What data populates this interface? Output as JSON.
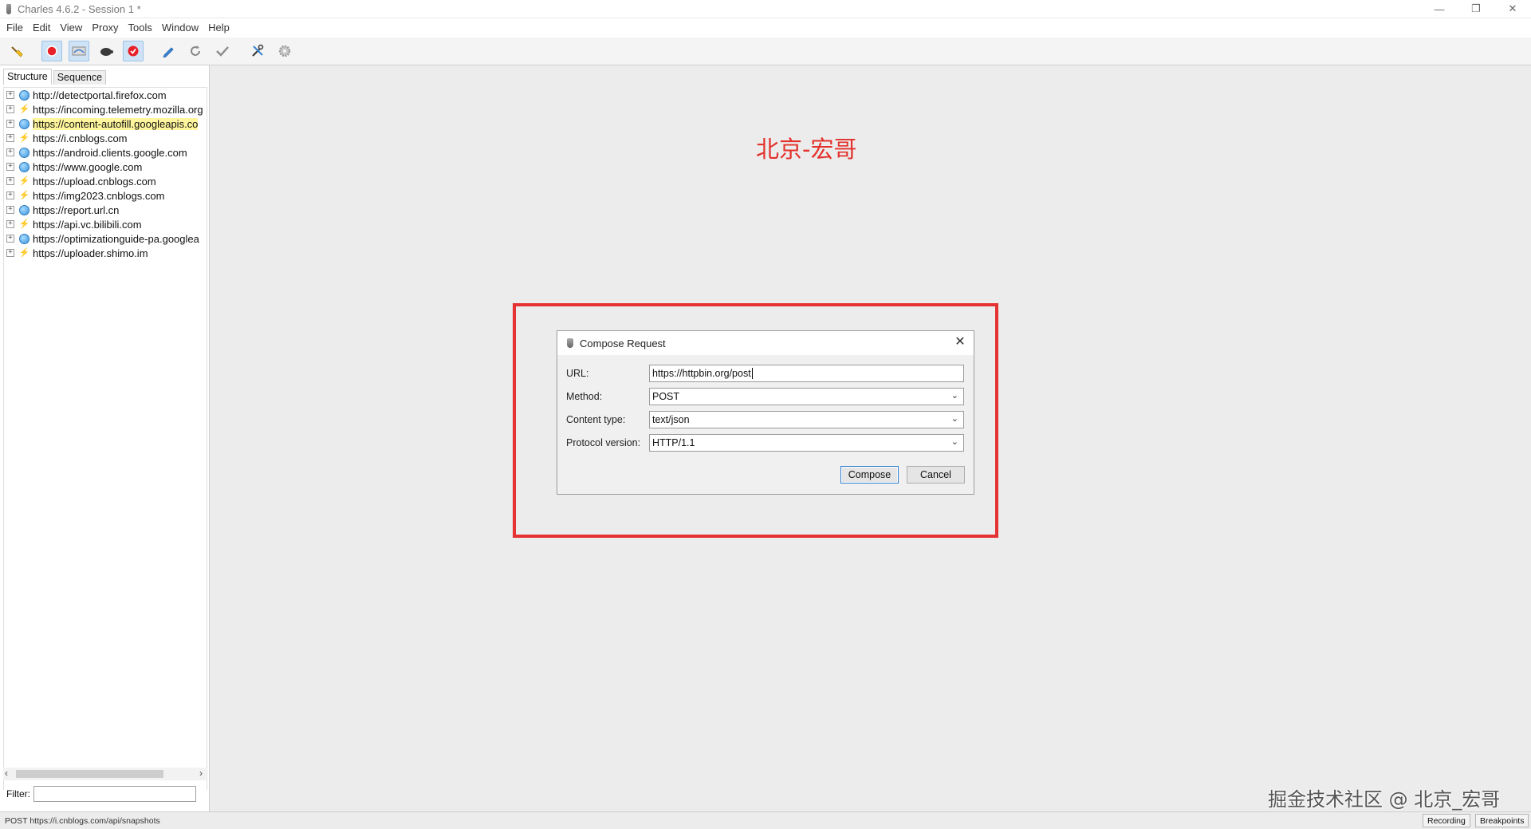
{
  "window": {
    "title": "Charles 4.6.2 - Session 1 *",
    "controls": [
      "—",
      "❐",
      "✕"
    ]
  },
  "menu": [
    "File",
    "Edit",
    "View",
    "Proxy",
    "Tools",
    "Window",
    "Help"
  ],
  "toolbar": {
    "buttons": [
      "broom-icon",
      "record-icon",
      "throttle-icon",
      "turtle-icon",
      "breakpoint-icon",
      "compose-pen-icon",
      "repeat-icon",
      "validate-check-icon",
      "tools-icon",
      "settings-gear-icon"
    ]
  },
  "left_panel": {
    "tabs": {
      "structure": "Structure",
      "sequence": "Sequence"
    },
    "hosts": [
      {
        "label": "http://detectportal.firefox.com",
        "icon": "globe",
        "highlighted": false
      },
      {
        "label": "https://incoming.telemetry.mozilla.org",
        "icon": "bolt",
        "highlighted": false
      },
      {
        "label": "https://content-autofill.googleapis.co",
        "icon": "globe",
        "highlighted": true
      },
      {
        "label": "https://i.cnblogs.com",
        "icon": "bolt",
        "highlighted": false
      },
      {
        "label": "https://android.clients.google.com",
        "icon": "globe",
        "highlighted": false
      },
      {
        "label": "https://www.google.com",
        "icon": "globe",
        "highlighted": false
      },
      {
        "label": "https://upload.cnblogs.com",
        "icon": "bolt",
        "highlighted": false
      },
      {
        "label": "https://img2023.cnblogs.com",
        "icon": "bolt",
        "highlighted": false
      },
      {
        "label": "https://report.url.cn",
        "icon": "globe",
        "highlighted": false
      },
      {
        "label": "https://api.vc.bilibili.com",
        "icon": "bolt",
        "highlighted": false
      },
      {
        "label": "https://optimizationguide-pa.googlea",
        "icon": "globe",
        "highlighted": false
      },
      {
        "label": "https://uploader.shimo.im",
        "icon": "bolt",
        "highlighted": false
      }
    ],
    "filter_label": "Filter:",
    "filter_value": ""
  },
  "main": {
    "watermark_top": "北京-宏哥",
    "watermark_bottom": "掘金技术社区 @ 北京_宏哥",
    "frame_color": "#e53233"
  },
  "dialog": {
    "title": "Compose Request",
    "fields": {
      "url_label": "URL:",
      "url_value": "https://httpbin.org/post",
      "method_label": "Method:",
      "method_value": "POST",
      "content_type_label": "Content type:",
      "content_type_value": "text/json",
      "protocol_label": "Protocol version:",
      "protocol_value": "HTTP/1.1"
    },
    "compose_button": "Compose",
    "cancel_button": "Cancel"
  },
  "status_bar": {
    "text": "POST https://i.cnblogs.com/api/snapshots",
    "recording": "Recording",
    "breakpoints": "Breakpoints"
  }
}
